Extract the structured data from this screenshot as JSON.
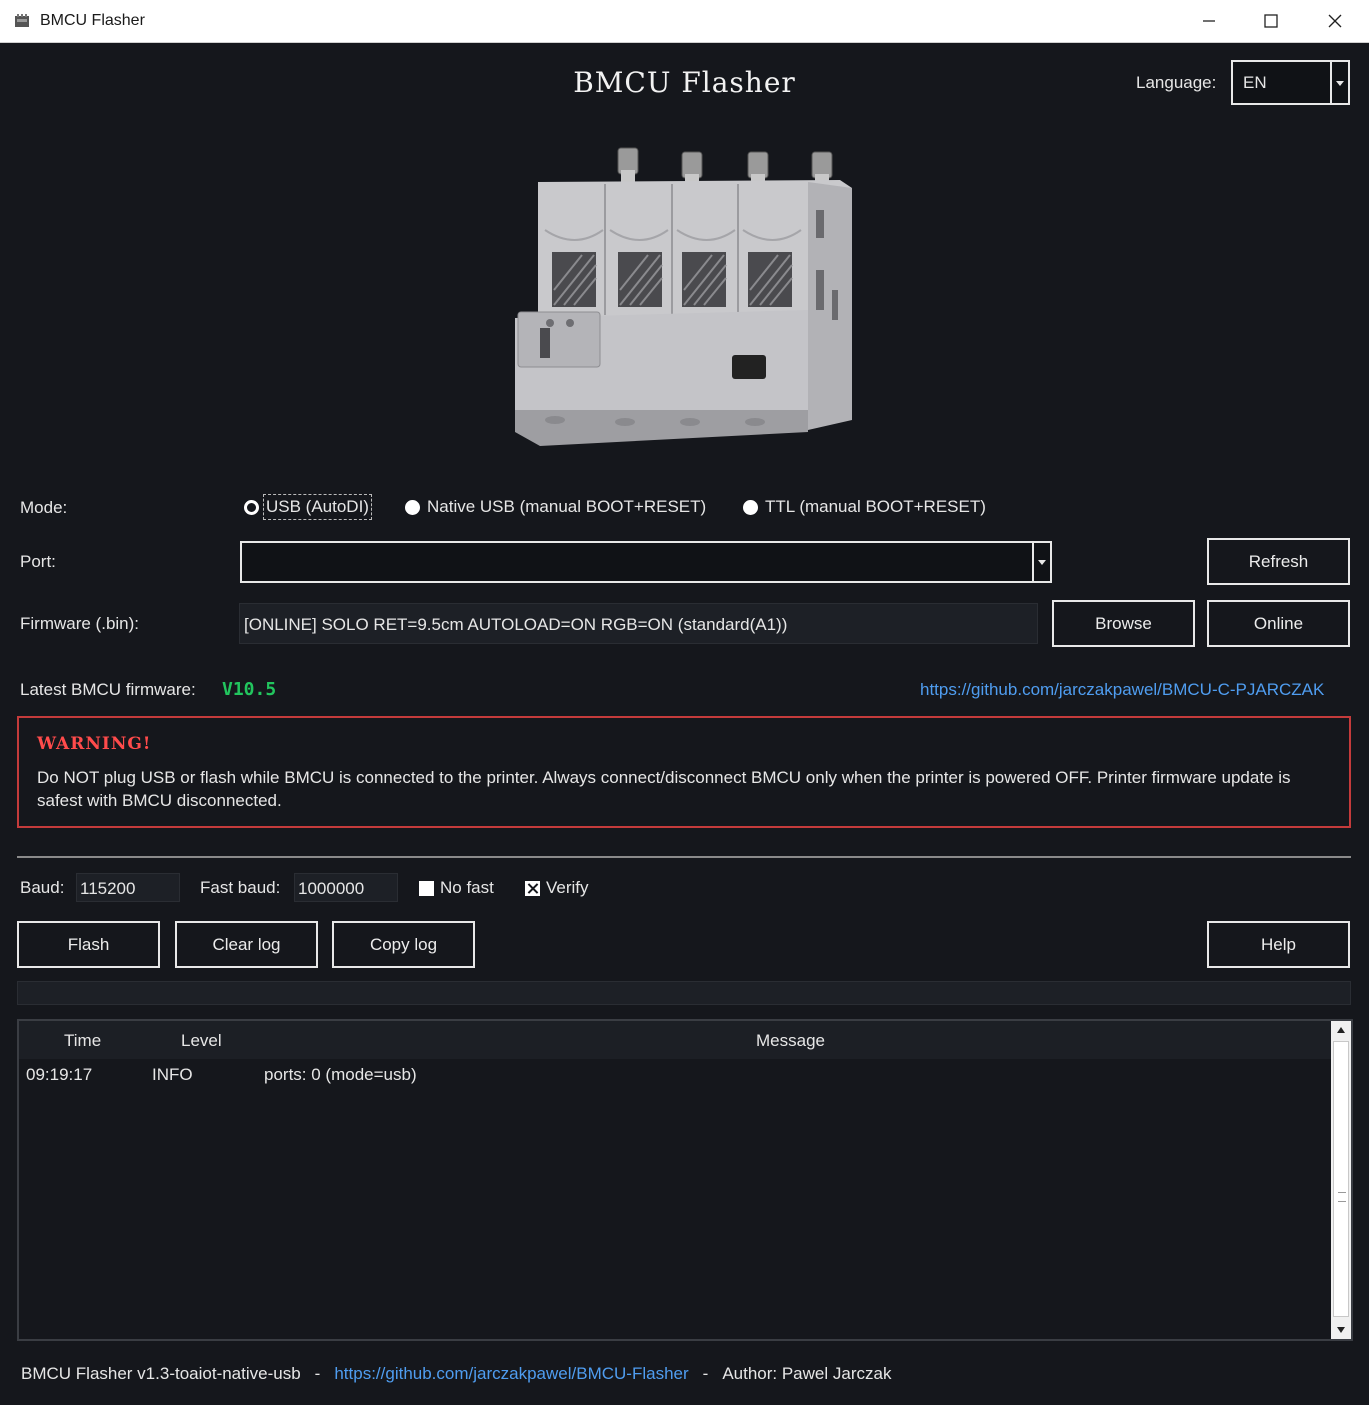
{
  "window": {
    "title": "BMCU Flasher",
    "controls": {
      "minimize_icon": "minimize-icon",
      "maximize_icon": "maximize-icon",
      "close_icon": "close-icon"
    }
  },
  "header": {
    "app_title": "BMCU Flasher",
    "language_label": "Language:",
    "language_value": "EN"
  },
  "mode": {
    "label": "Mode:",
    "options": [
      {
        "label": "USB (AutoDI)",
        "selected": true
      },
      {
        "label": "Native USB (manual BOOT+RESET)",
        "selected": false
      },
      {
        "label": "TTL (manual BOOT+RESET)",
        "selected": false
      }
    ]
  },
  "port": {
    "label": "Port:",
    "value": "",
    "refresh_label": "Refresh"
  },
  "firmware": {
    "label": "Firmware (.bin):",
    "value": "[ONLINE] SOLO RET=9.5cm AUTOLOAD=ON RGB=ON (standard(A1))",
    "browse_label": "Browse",
    "online_label": "Online"
  },
  "latest": {
    "label": "Latest BMCU firmware:",
    "version": "V10.5",
    "link": "https://github.com/jarczakpawel/BMCU-C-PJARCZAK"
  },
  "warning": {
    "title": "WARNING!",
    "body": "Do NOT plug USB or flash while BMCU is connected to the printer. Always connect/disconnect BMCU only when the printer is powered OFF. Printer firmware update is safest with BMCU disconnected."
  },
  "settings": {
    "baud_label": "Baud:",
    "baud_value": "115200",
    "fast_baud_label": "Fast baud:",
    "fast_baud_value": "1000000",
    "no_fast_label": "No fast",
    "no_fast_checked": false,
    "verify_label": "Verify",
    "verify_checked": true
  },
  "actions": {
    "flash_label": "Flash",
    "clear_log_label": "Clear log",
    "copy_log_label": "Copy log",
    "help_label": "Help"
  },
  "progress": {
    "value": 0
  },
  "log": {
    "columns": [
      "Time",
      "Level",
      "Message"
    ],
    "rows": [
      {
        "time": "09:19:17",
        "level": "INFO",
        "message": "ports: 0 (mode=usb)"
      }
    ]
  },
  "footer": {
    "version": "BMCU Flasher v1.3-toaiot-native-usb",
    "separator": "-",
    "link": "https://github.com/jarczakpawel/BMCU-Flasher",
    "author": "Author: Pawel Jarczak"
  },
  "colors": {
    "background": "#15171c",
    "accent_green": "#22c55e",
    "link_blue": "#4f9df0",
    "warning_red": "#c43b3b"
  }
}
